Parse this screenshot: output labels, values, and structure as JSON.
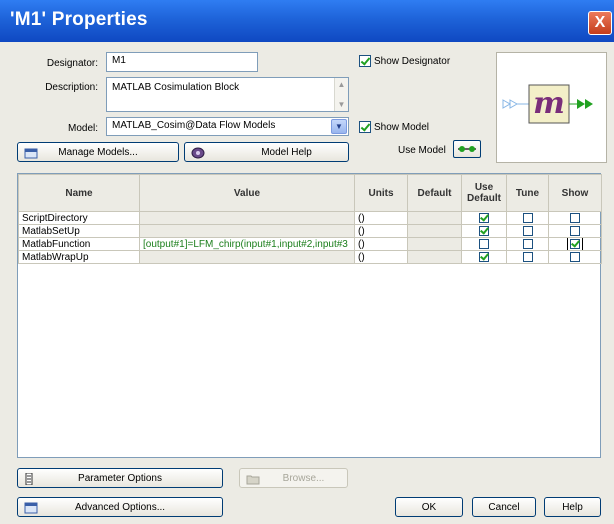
{
  "window": {
    "title": "'M1' Properties",
    "close_glyph": "X"
  },
  "form": {
    "designator_label": "Designator:",
    "designator_value": "M1",
    "description_label": "Description:",
    "description_value": "MATLAB Cosimulation Block",
    "model_label": "Model:",
    "model_value": "MATLAB_Cosim@Data Flow Models",
    "show_designator_label": "Show Designator",
    "show_designator_checked": true,
    "show_model_label": "Show Model",
    "show_model_checked": true,
    "use_model_label": "Use Model",
    "manage_models_label": "Manage Models...",
    "model_help_label": "Model Help"
  },
  "preview": {
    "symbol_letter": "m"
  },
  "grid": {
    "headers": {
      "name": "Name",
      "value": "Value",
      "units": "Units",
      "default": "Default",
      "use_default": "Use Default",
      "tune": "Tune",
      "show": "Show"
    },
    "rows": [
      {
        "name": "ScriptDirectory",
        "value": "",
        "units": "()",
        "use_default": true,
        "tune": false,
        "show": false
      },
      {
        "name": "MatlabSetUp",
        "value": "",
        "units": "()",
        "use_default": true,
        "tune": false,
        "show": false
      },
      {
        "name": "MatlabFunction",
        "value": "[output#1]=LFM_chirp(input#1,input#2,input#3",
        "units": "()",
        "use_default": false,
        "tune": false,
        "show": true
      },
      {
        "name": "MatlabWrapUp",
        "value": "",
        "units": "()",
        "use_default": true,
        "tune": false,
        "show": false
      }
    ]
  },
  "buttons": {
    "parameter_options": "Parameter Options",
    "browse": "Browse...",
    "advanced_options": "Advanced Options...",
    "ok": "OK",
    "cancel": "Cancel",
    "help": "Help"
  },
  "colors": {
    "titlebar": "#1e63d9",
    "checkmark": "#21a121",
    "value_text": "#1b7e1b"
  }
}
